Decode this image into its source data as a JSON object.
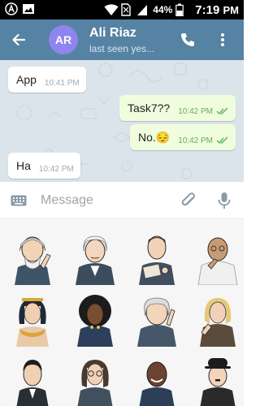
{
  "status_bar": {
    "battery_percent": "44%",
    "time": "7:19",
    "time_suffix": "PM",
    "icons": [
      "app-notification-icon",
      "image-notification-icon",
      "wifi-icon",
      "no-sim-icon",
      "signal-icon",
      "battery-icon"
    ]
  },
  "header": {
    "avatar_initials": "AR",
    "name": "Ali Riaz",
    "status": "last seen yes...",
    "colors": {
      "bar": "#5682a3",
      "avatar": "#8e85ee"
    }
  },
  "messages": [
    {
      "direction": "incoming",
      "text": "App",
      "time": "10:41 PM"
    },
    {
      "direction": "outgoing",
      "text": "Task7??",
      "time": "10:42 PM",
      "read": true
    },
    {
      "direction": "outgoing",
      "text": "No.😔",
      "time": "10:42 PM",
      "read": true
    },
    {
      "direction": "incoming",
      "text": "Ha",
      "time": "10:42 PM"
    }
  ],
  "input": {
    "placeholder": "Message",
    "value": ""
  },
  "stickers": {
    "pack": "famous people",
    "count_visible": 12
  }
}
